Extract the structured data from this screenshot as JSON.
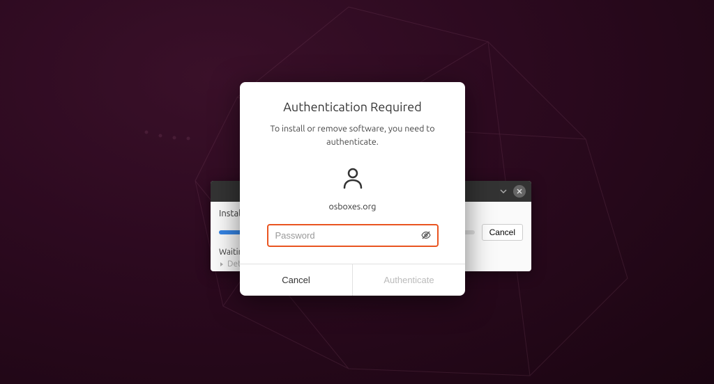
{
  "installer": {
    "title": "Install",
    "cancel_label": "Cancel",
    "waiting_label": "Waiting",
    "details_label": "Details"
  },
  "auth": {
    "title": "Authentication Required",
    "message": "To install or remove software, you need to authenticate.",
    "username": "osboxes.org",
    "password_placeholder": "Password",
    "cancel_label": "Cancel",
    "authenticate_label": "Authenticate"
  }
}
